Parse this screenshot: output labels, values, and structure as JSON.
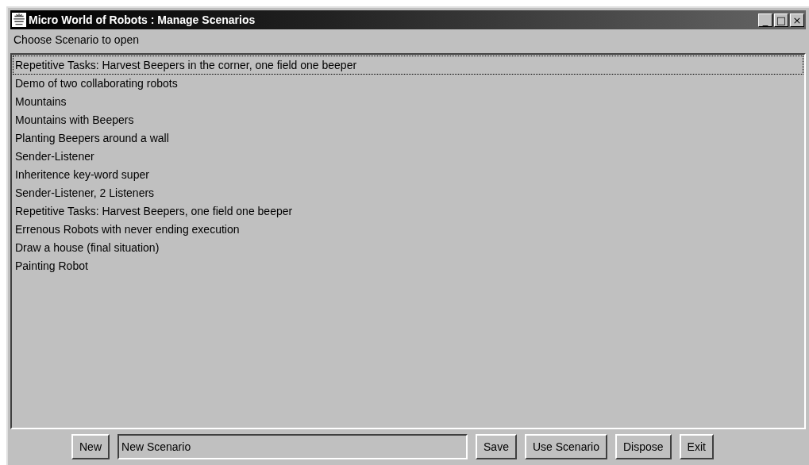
{
  "window": {
    "title": "Micro World of Robots : Manage Scenarios",
    "controls": [
      "_",
      "□",
      "×"
    ]
  },
  "prompt": "Choose Scenario to open",
  "scenarios": [
    {
      "label": "Repetitive Tasks: Harvest Beepers in the corner, one field one beeper",
      "selected": true
    },
    {
      "label": "Demo of two collaborating robots",
      "selected": false
    },
    {
      "label": "Mountains",
      "selected": false
    },
    {
      "label": "Mountains with Beepers",
      "selected": false
    },
    {
      "label": "Planting Beepers around a wall",
      "selected": false
    },
    {
      "label": "Sender-Listener",
      "selected": false
    },
    {
      "label": "Inheritence key-word super",
      "selected": false
    },
    {
      "label": "Sender-Listener, 2 Listeners",
      "selected": false
    },
    {
      "label": "Repetitive Tasks: Harvest Beepers, one field one beeper",
      "selected": false
    },
    {
      "label": "Errenous Robots with never ending execution",
      "selected": false
    },
    {
      "label": "Draw a house (final situation)",
      "selected": false
    },
    {
      "label": "Painting Robot",
      "selected": false
    }
  ],
  "toolbar": [
    {
      "kind": "button",
      "label": "New"
    },
    {
      "kind": "field",
      "value": "New Scenario"
    },
    {
      "kind": "button",
      "label": "Save"
    },
    {
      "kind": "button",
      "label": "Use Scenario"
    },
    {
      "kind": "button",
      "label": "Dispose"
    },
    {
      "kind": "button",
      "label": "Exit"
    }
  ]
}
